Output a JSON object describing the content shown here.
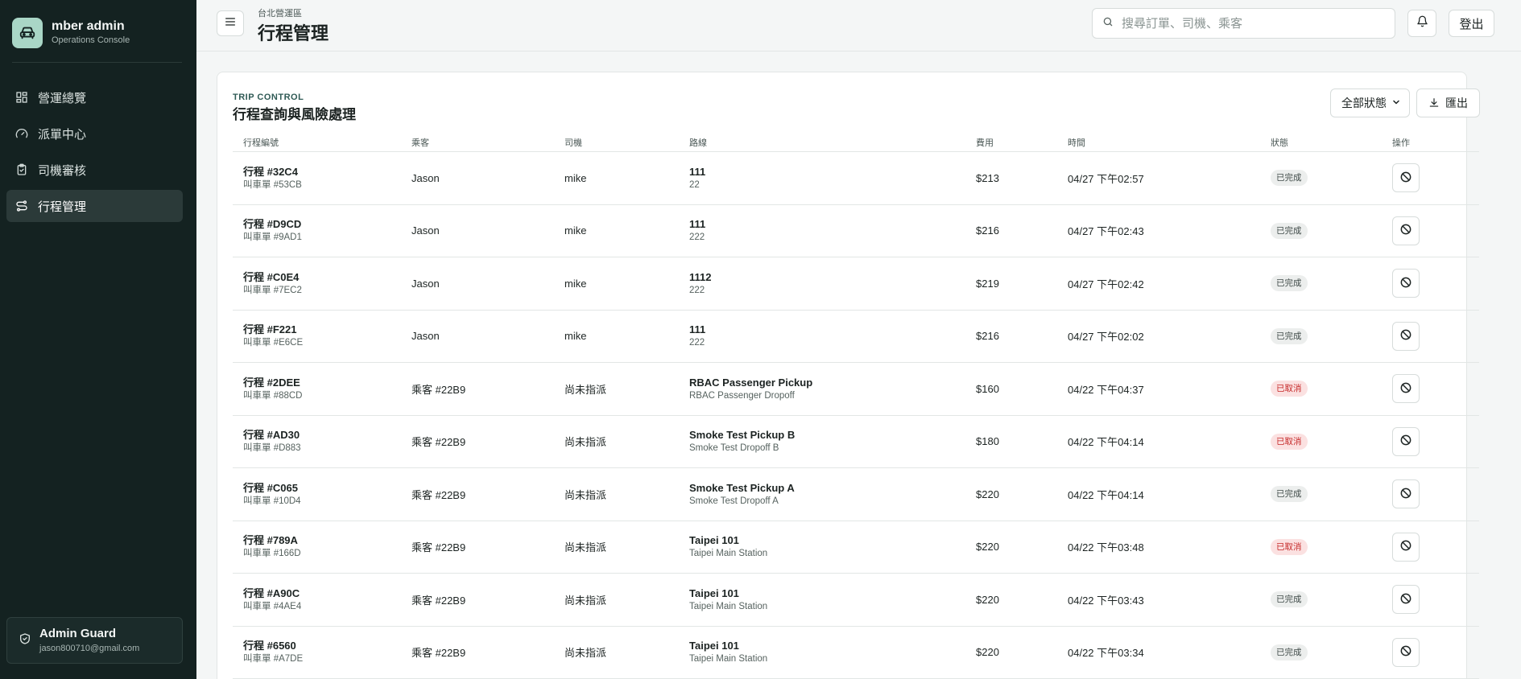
{
  "sidebar": {
    "brand_name": "mber admin",
    "brand_sub": "Operations Console",
    "nav": [
      {
        "label": "營運總覽",
        "icon": "dashboard-icon"
      },
      {
        "label": "派單中心",
        "icon": "gauge-icon"
      },
      {
        "label": "司機審核",
        "icon": "clipboard-check-icon"
      },
      {
        "label": "行程管理",
        "icon": "route-icon",
        "active": true
      }
    ],
    "user": {
      "name": "Admin Guard",
      "email": "jason800710@gmail.com"
    }
  },
  "header": {
    "region": "台北營運區",
    "title": "行程管理",
    "search_placeholder": "搜尋訂單、司機、乘客",
    "logout_label": "登出"
  },
  "panel": {
    "kicker": "TRIP CONTROL",
    "title": "行程查詢與風險處理",
    "status_filter": "全部狀態",
    "export_label": "匯出"
  },
  "table": {
    "columns": [
      "行程編號",
      "乘客",
      "司機",
      "路線",
      "費用",
      "時間",
      "狀態",
      "操作"
    ],
    "rows": [
      {
        "trip": "行程 #32C4",
        "order": "叫車單 #53CB",
        "passenger": "Jason",
        "driver": "mike",
        "from": "111",
        "to": "22",
        "fee": "$213",
        "time": "04/27 下午02:57",
        "status": "已完成",
        "status_type": "done"
      },
      {
        "trip": "行程 #D9CD",
        "order": "叫車單 #9AD1",
        "passenger": "Jason",
        "driver": "mike",
        "from": "111",
        "to": "222",
        "fee": "$216",
        "time": "04/27 下午02:43",
        "status": "已完成",
        "status_type": "done"
      },
      {
        "trip": "行程 #C0E4",
        "order": "叫車單 #7EC2",
        "passenger": "Jason",
        "driver": "mike",
        "from": "1112",
        "to": "222",
        "fee": "$219",
        "time": "04/27 下午02:42",
        "status": "已完成",
        "status_type": "done"
      },
      {
        "trip": "行程 #F221",
        "order": "叫車單 #E6CE",
        "passenger": "Jason",
        "driver": "mike",
        "from": "111",
        "to": "222",
        "fee": "$216",
        "time": "04/27 下午02:02",
        "status": "已完成",
        "status_type": "done"
      },
      {
        "trip": "行程 #2DEE",
        "order": "叫車單 #88CD",
        "passenger": "乘客 #22B9",
        "driver": "尚未指派",
        "from": "RBAC Passenger Pickup",
        "to": "RBAC Passenger Dropoff",
        "fee": "$160",
        "time": "04/22 下午04:37",
        "status": "已取消",
        "status_type": "cancel"
      },
      {
        "trip": "行程 #AD30",
        "order": "叫車單 #D883",
        "passenger": "乘客 #22B9",
        "driver": "尚未指派",
        "from": "Smoke Test Pickup B",
        "to": "Smoke Test Dropoff B",
        "fee": "$180",
        "time": "04/22 下午04:14",
        "status": "已取消",
        "status_type": "cancel"
      },
      {
        "trip": "行程 #C065",
        "order": "叫車單 #10D4",
        "passenger": "乘客 #22B9",
        "driver": "尚未指派",
        "from": "Smoke Test Pickup A",
        "to": "Smoke Test Dropoff A",
        "fee": "$220",
        "time": "04/22 下午04:14",
        "status": "已完成",
        "status_type": "done"
      },
      {
        "trip": "行程 #789A",
        "order": "叫車單 #166D",
        "passenger": "乘客 #22B9",
        "driver": "尚未指派",
        "from": "Taipei 101",
        "to": "Taipei Main Station",
        "fee": "$220",
        "time": "04/22 下午03:48",
        "status": "已取消",
        "status_type": "cancel"
      },
      {
        "trip": "行程 #A90C",
        "order": "叫車單 #4AE4",
        "passenger": "乘客 #22B9",
        "driver": "尚未指派",
        "from": "Taipei 101",
        "to": "Taipei Main Station",
        "fee": "$220",
        "time": "04/22 下午03:43",
        "status": "已完成",
        "status_type": "done"
      },
      {
        "trip": "行程 #6560",
        "order": "叫車單 #A7DE",
        "passenger": "乘客 #22B9",
        "driver": "尚未指派",
        "from": "Taipei 101",
        "to": "Taipei Main Station",
        "fee": "$220",
        "time": "04/22 下午03:34",
        "status": "已完成",
        "status_type": "done"
      }
    ]
  },
  "colors": {
    "sidebar_bg": "#142221",
    "accent": "#a9d6c6",
    "cancel_badge_bg": "#fbe1e1",
    "cancel_badge_text": "#c52828"
  }
}
